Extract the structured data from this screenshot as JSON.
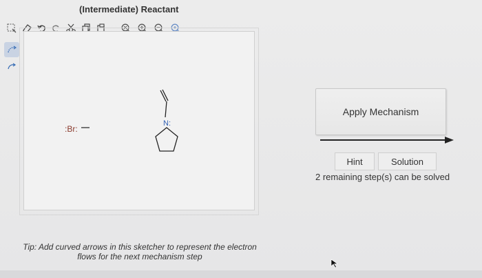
{
  "header": {
    "title": "(Intermediate) Reactant"
  },
  "toolbar": {
    "tools": [
      {
        "icon": "selection-icon"
      },
      {
        "icon": "eraser-icon"
      },
      {
        "icon": "undo-icon"
      },
      {
        "icon": "redo-icon"
      },
      {
        "icon": "cut-icon"
      },
      {
        "icon": "copy-icon"
      },
      {
        "icon": "paste-icon"
      },
      {
        "icon": "zoom-reset-icon"
      },
      {
        "icon": "zoom-in-icon"
      },
      {
        "icon": "zoom-out-icon"
      },
      {
        "icon": "zoom-fit-icon"
      }
    ]
  },
  "side_tools": [
    {
      "icon": "curved-arrow-double-icon",
      "active": true
    },
    {
      "icon": "curved-arrow-single-icon",
      "active": false
    }
  ],
  "molecule": {
    "bromide_label": ":Br:",
    "bromide_charge": "−",
    "nitrogen_label": "N:"
  },
  "tip": {
    "line1": "Tip: Add curved arrows in this sketcher to represent the electron",
    "line2": "flows for the next mechanism step"
  },
  "actions": {
    "apply_label": "Apply Mechanism",
    "hint_label": "Hint",
    "solution_label": "Solution",
    "remaining_text": "2 remaining step(s) can be solved"
  },
  "colors": {
    "accent": "#3b6fb6",
    "nitrogen": "#2f5fb3",
    "bromine": "#8a3b2e",
    "arrow": "#222222"
  }
}
